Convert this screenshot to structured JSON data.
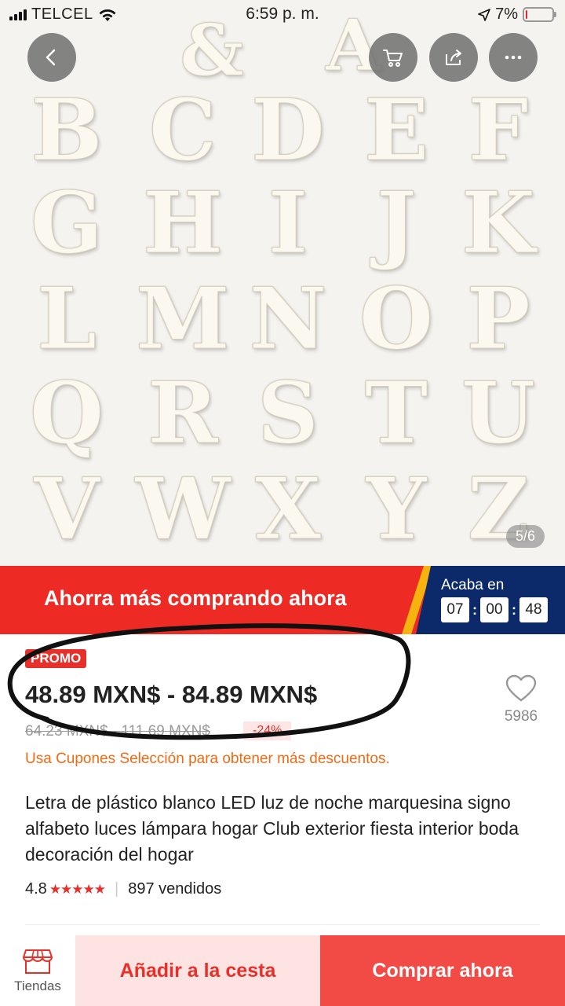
{
  "status_bar": {
    "carrier": "TELCEL",
    "time": "6:59 p. m.",
    "battery": "7%",
    "battery_level": 0.07
  },
  "nav": {
    "back_icon": "chevron-left-icon",
    "cart_icon": "cart-icon",
    "share_icon": "share-icon",
    "more_icon": "more-icon"
  },
  "gallery": {
    "top_letters": [
      "&",
      "A"
    ],
    "letters": [
      "B",
      "C",
      "D",
      "E",
      "F",
      "G",
      "H",
      "I",
      "J",
      "K",
      "L",
      "M",
      "N",
      "O",
      "P",
      "Q",
      "R",
      "S",
      "T",
      "U",
      "V",
      "W",
      "X",
      "Y",
      "Z"
    ],
    "counter": "5/6"
  },
  "promo_banner": {
    "text": "Ahorra más comprando ahora",
    "ends_label": "Acaba en",
    "countdown": [
      "07",
      "00",
      "48"
    ],
    "colors": {
      "red": "#ee2a24",
      "navy": "#0c2a6a",
      "yellow": "#f6b20f"
    }
  },
  "price": {
    "tag": "PROMO",
    "range": "48.89 MXN$ - 84.89 MXN$",
    "original": "64.23 MXN$ - 111.69 MXN$",
    "discount": "-24%",
    "coupon_note": "Usa Cupones Selección para obtener más descuentos."
  },
  "wishlist": {
    "icon": "heart-icon",
    "count": "5986"
  },
  "product": {
    "title": "Letra de plástico blanco LED luz de noche marquesina signo alfabeto luces lámpara hogar Club exterior fiesta interior boda decoración del hogar",
    "rating": "4.8",
    "stars": "★★★★★",
    "sold": "897 vendidos"
  },
  "bottom_bar": {
    "stores_label": "Tiendas",
    "stores_icon": "store-icon",
    "add_to_cart": "Añadir a la cesta",
    "buy_now": "Comprar ahora"
  }
}
